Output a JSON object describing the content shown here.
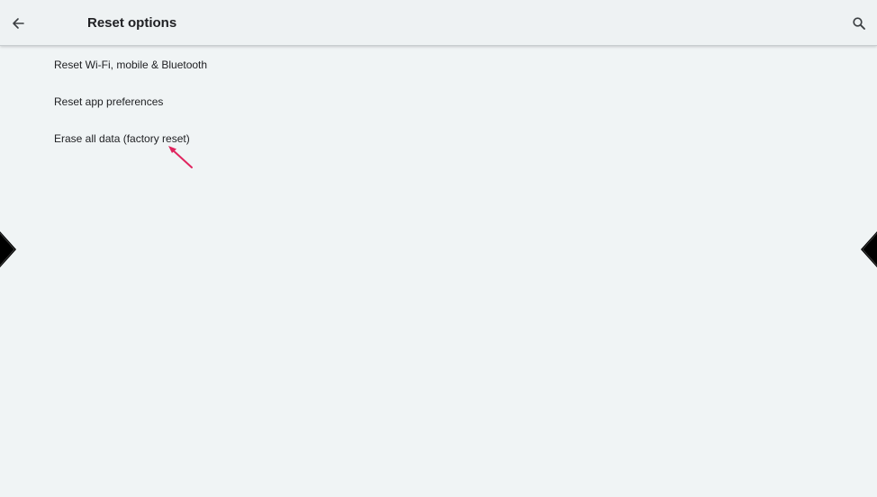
{
  "header": {
    "title": "Reset options",
    "back_icon": "arrow-left-icon",
    "search_icon": "search-icon"
  },
  "options": [
    {
      "label": "Reset Wi‑Fi, mobile & Bluetooth"
    },
    {
      "label": "Reset app preferences"
    },
    {
      "label": "Erase all data (factory reset)"
    }
  ],
  "colors": {
    "background": "#f0f4f5",
    "pointer": "#e0245e"
  }
}
